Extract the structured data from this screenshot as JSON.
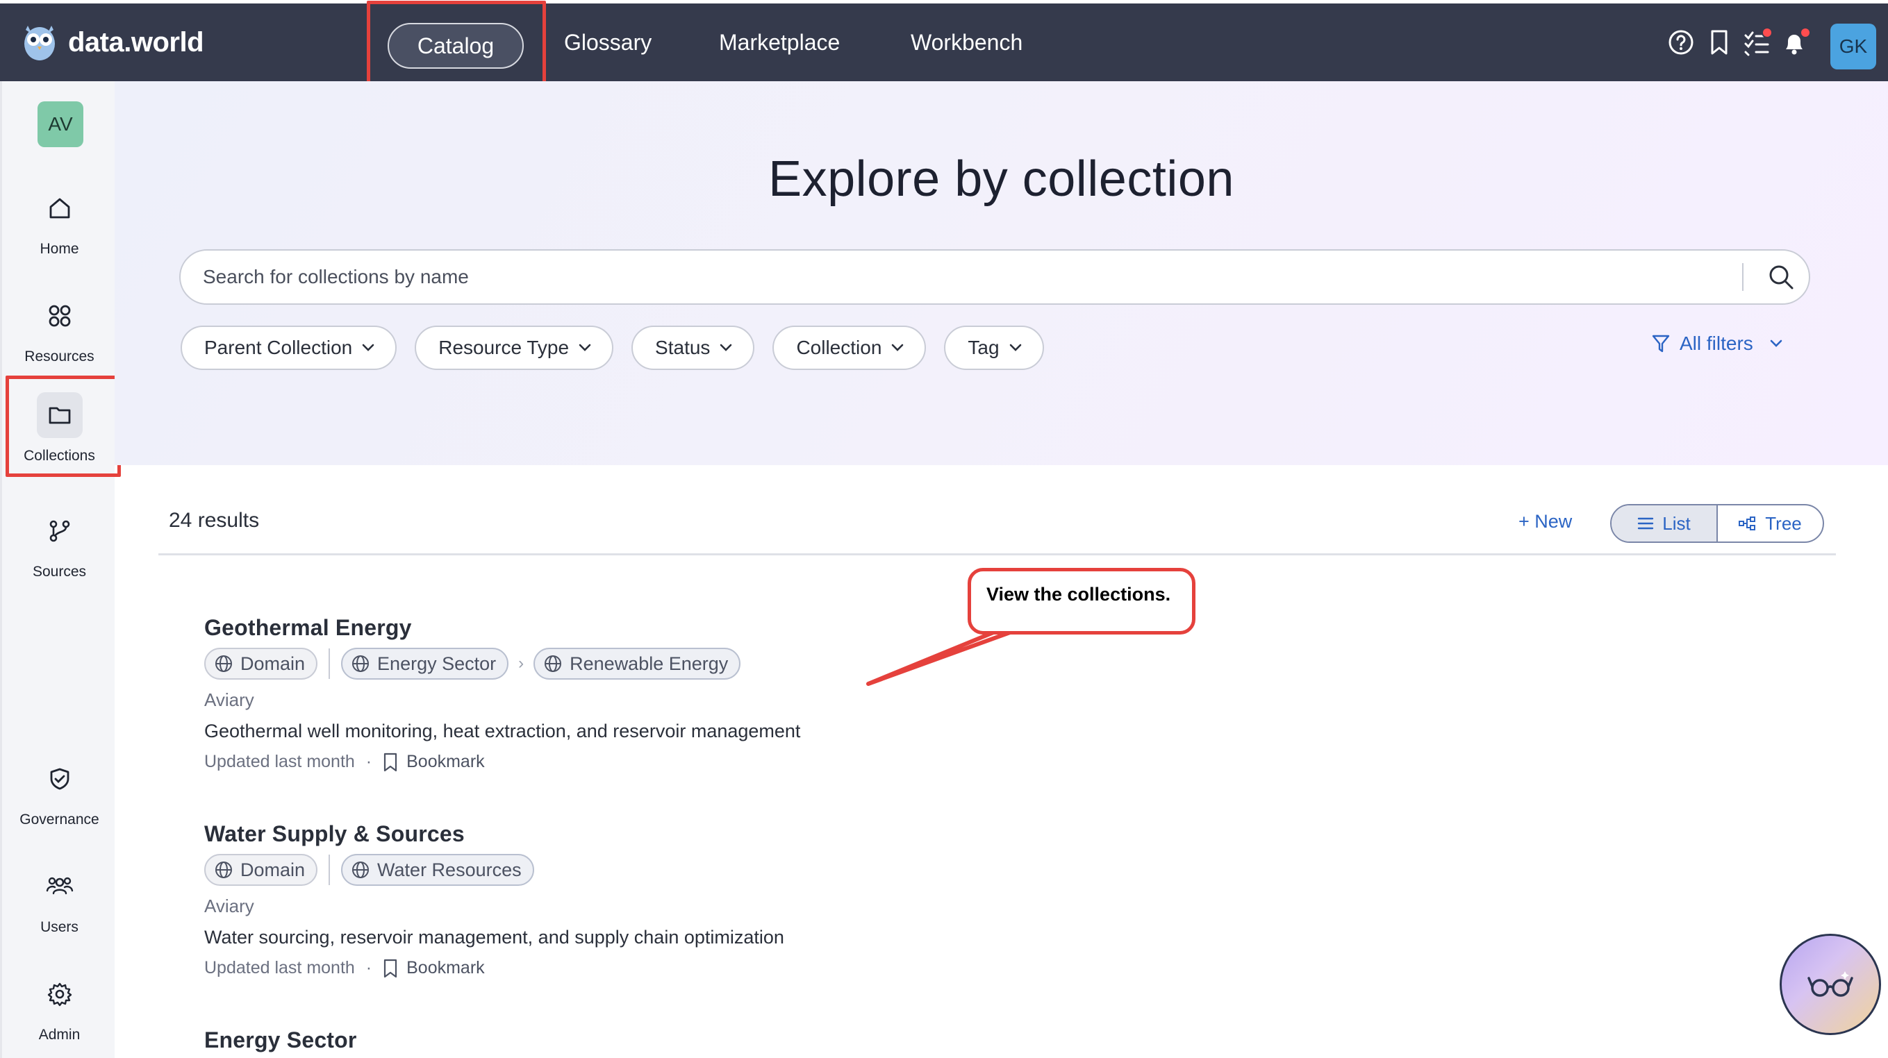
{
  "app": {
    "logo_text": "data.world",
    "nav": [
      "Catalog",
      "Glossary",
      "Marketplace",
      "Workbench"
    ],
    "active_nav": "Catalog",
    "user_initials": "GK",
    "icons": [
      "help-icon",
      "bookmark-icon",
      "tasks-icon",
      "notifications-icon"
    ]
  },
  "sidebar": {
    "org_initials": "AV",
    "items": [
      "Home",
      "Resources",
      "Collections",
      "Sources"
    ],
    "bottom_items": [
      "Governance",
      "Users",
      "Admin"
    ],
    "active": "Collections"
  },
  "hero": {
    "title": "Explore by collection",
    "search_placeholder": "Search for collections by name",
    "filters": [
      "Parent Collection",
      "Resource Type",
      "Status",
      "Collection",
      "Tag"
    ],
    "all_filters": "All filters"
  },
  "results": {
    "count": "24 results",
    "new_label": "+ New",
    "view_list": "List",
    "view_tree": "Tree",
    "active_view": "List"
  },
  "collections": [
    {
      "title": "Geothermal Energy",
      "type": "Domain",
      "path": [
        "Energy Sector",
        "Renewable Energy"
      ],
      "org": "Aviary",
      "description": "Geothermal well monitoring, heat extraction, and reservoir management",
      "updated": "Updated last month",
      "bookmark": "Bookmark"
    },
    {
      "title": "Water Supply & Sources",
      "type": "Domain",
      "path": [
        "Water Resources"
      ],
      "org": "Aviary",
      "description": "Water sourcing, reservoir management, and supply chain optimization",
      "updated": "Updated last month",
      "bookmark": "Bookmark"
    },
    {
      "title": "Energy Sector"
    }
  ],
  "callout": {
    "text": "View the collections."
  },
  "colors": {
    "topbar": "#353a4c",
    "accent": "#2b64c4",
    "highlight": "#e5413c"
  }
}
